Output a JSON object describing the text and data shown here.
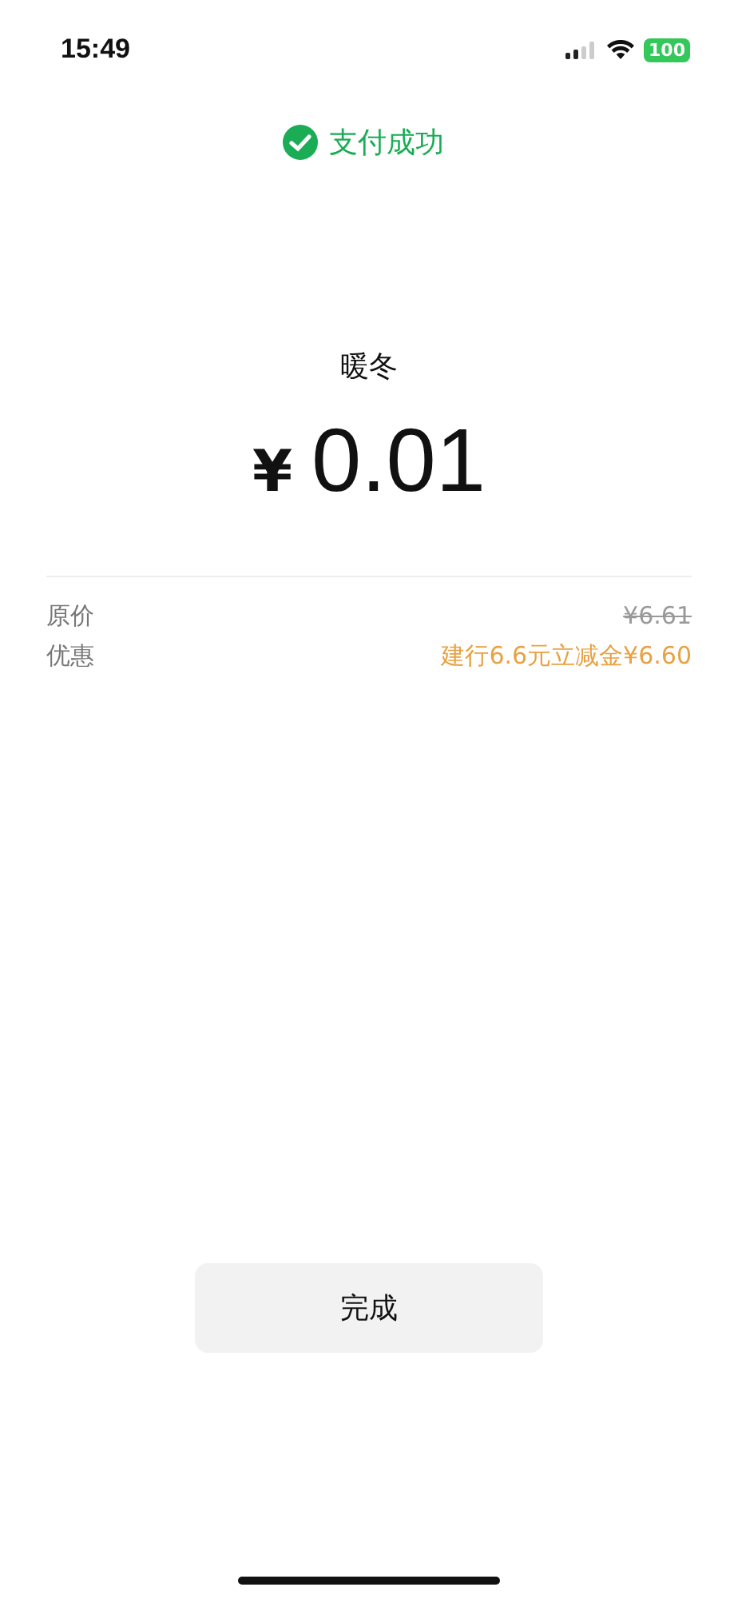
{
  "status_bar": {
    "time": "15:49",
    "battery": "100"
  },
  "result": {
    "title": "支付成功"
  },
  "merchant": "暖冬",
  "amount": {
    "currency": "¥",
    "value": "0.01"
  },
  "details": [
    {
      "label": "原价",
      "value": "¥6.61",
      "kind": "struck"
    },
    {
      "label": "优惠",
      "value": "建行6.6元立减金¥6.60",
      "kind": "discount"
    }
  ],
  "done_button": "完成"
}
